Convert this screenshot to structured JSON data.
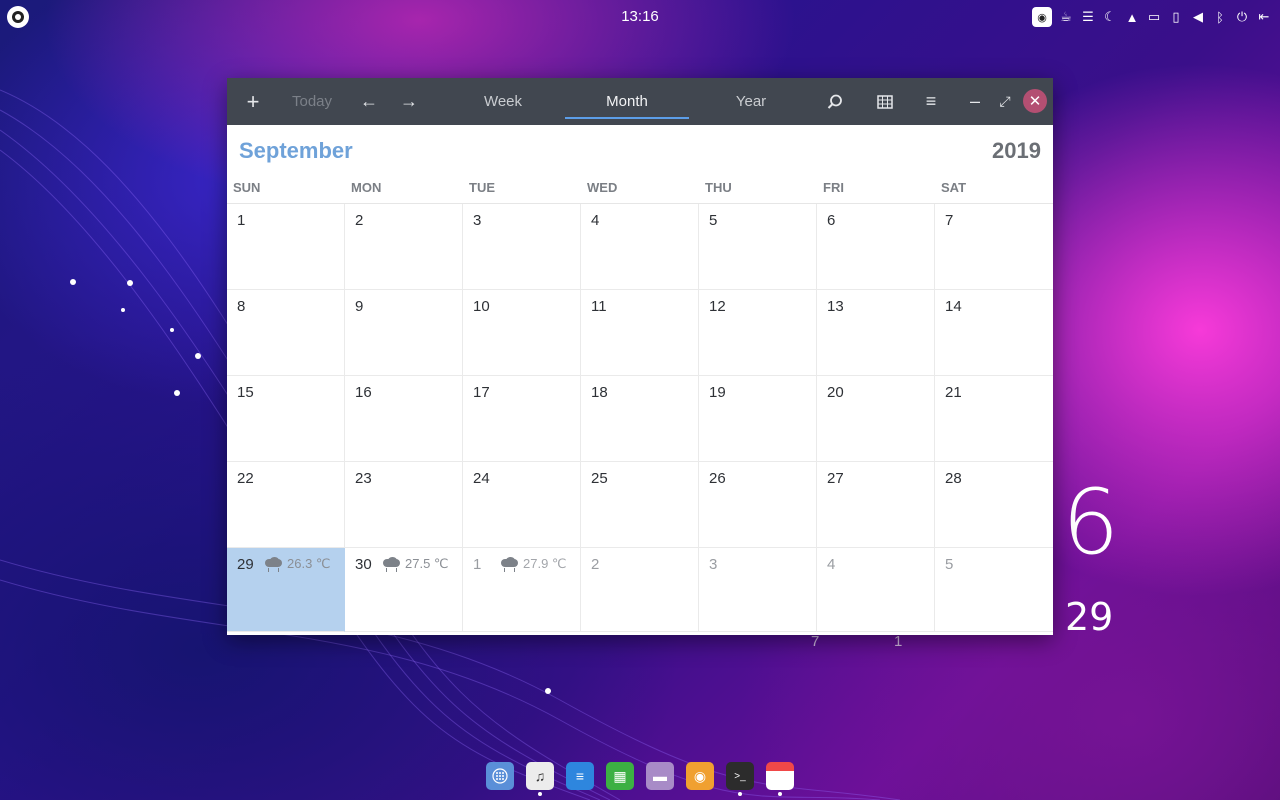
{
  "panel": {
    "clock": "13:16",
    "launcher_icon": "launcher-icon",
    "tray_icons": [
      "app-indicator-icon",
      "coffee-icon",
      "menu-icon",
      "night-mode-icon",
      "notifications-icon",
      "folder-icon",
      "battery-icon",
      "volume-icon",
      "bluetooth-icon",
      "power-icon",
      "logout-icon"
    ]
  },
  "toolbar": {
    "add_label": "+",
    "today_label": "Today",
    "prev_label": "←",
    "next_label": "→",
    "week_label": "Week",
    "month_label": "Month",
    "year_label": "Year",
    "menu_label": "≡",
    "minimize_label": "–",
    "maximize_label": "⤢",
    "close_label": "✕"
  },
  "calendar": {
    "month": "September",
    "year": "2019",
    "weekdays": [
      "SUN",
      "MON",
      "TUE",
      "WED",
      "THU",
      "FRI",
      "SAT"
    ],
    "weeks": [
      [
        "1",
        "2",
        "3",
        "4",
        "5",
        "6",
        "7"
      ],
      [
        "8",
        "9",
        "10",
        "11",
        "12",
        "13",
        "14"
      ],
      [
        "15",
        "16",
        "17",
        "18",
        "19",
        "20",
        "21"
      ],
      [
        "22",
        "23",
        "24",
        "25",
        "26",
        "27",
        "28"
      ],
      [
        "29",
        "30",
        "1",
        "2",
        "3",
        "4",
        "5"
      ]
    ],
    "weather": {
      "29": "26.3 ℃",
      "30": "27.5 ℃",
      "oct1": "27.9 ℃"
    }
  },
  "desktop_widget": {
    "day": "6",
    "date": "29",
    "frag1": "7",
    "frag2": "1"
  },
  "dock": [
    {
      "name": "launcher-app-icon",
      "color": "#5a8fd8"
    },
    {
      "name": "music-app-icon",
      "color": "#e8e8e8"
    },
    {
      "name": "text-editor-app-icon",
      "color": "#2e86de"
    },
    {
      "name": "spreadsheet-app-icon",
      "color": "#3cb043"
    },
    {
      "name": "files-app-icon",
      "color": "#a88bc7"
    },
    {
      "name": "browser-app-icon",
      "color": "#f0a030"
    },
    {
      "name": "terminal-app-icon",
      "color": "#2c2c2c"
    },
    {
      "name": "calendar-app-icon",
      "color": "#f04848"
    }
  ]
}
